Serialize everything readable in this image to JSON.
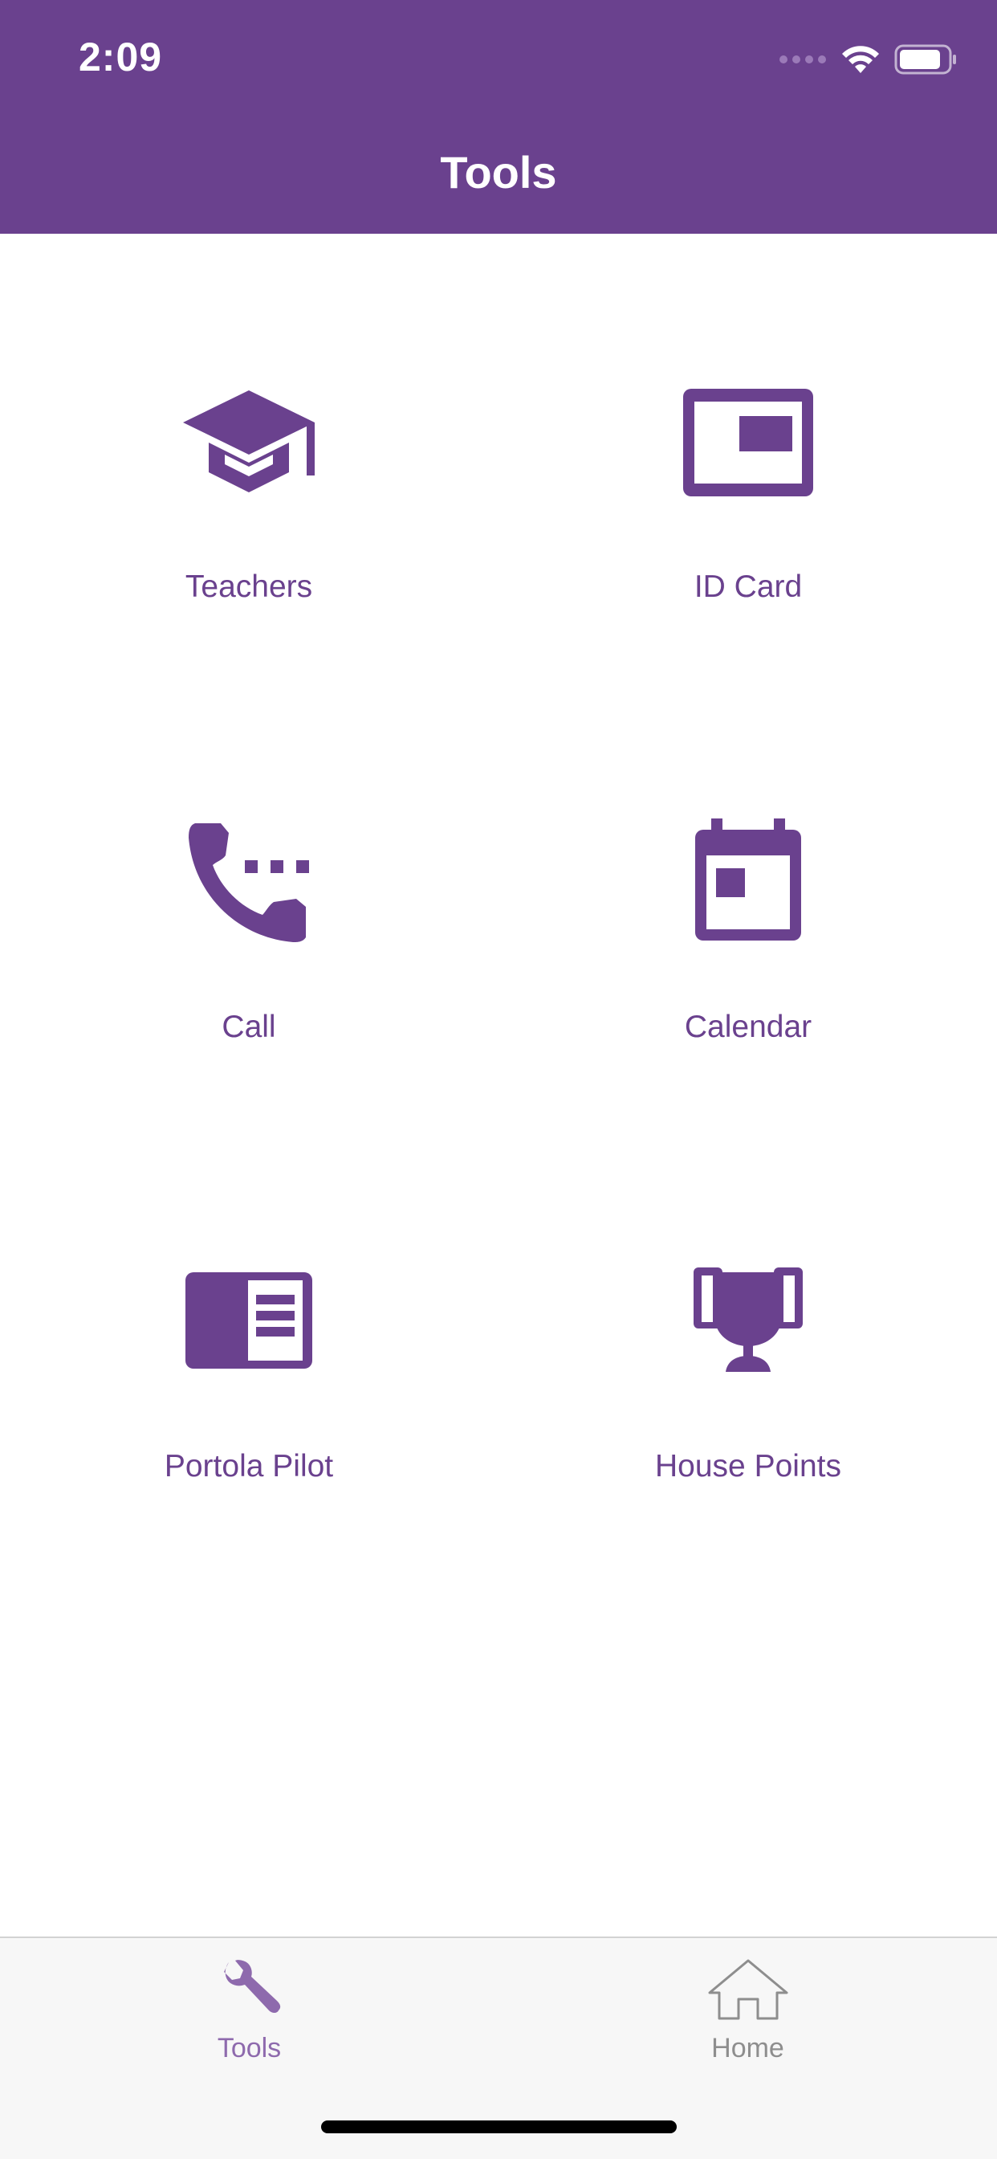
{
  "status_bar": {
    "time": "2:09"
  },
  "header": {
    "title": "Tools"
  },
  "colors": {
    "brand_purple": "#6a418e",
    "tab_active": "#8e6aad",
    "tab_inactive": "#8e8e8e",
    "background": "#ffffff",
    "tab_bar_bg": "#f7f7f7"
  },
  "tools": [
    {
      "label": "Teachers",
      "icon": "graduation-cap-icon"
    },
    {
      "label": "ID Card",
      "icon": "id-card-icon"
    },
    {
      "label": "Call",
      "icon": "phone-call-icon"
    },
    {
      "label": "Calendar",
      "icon": "calendar-icon"
    },
    {
      "label": "Portola Pilot",
      "icon": "newspaper-icon"
    },
    {
      "label": "House Points",
      "icon": "trophy-icon"
    }
  ],
  "tab_bar": {
    "tabs": [
      {
        "label": "Tools",
        "icon": "wrench-icon",
        "active": true
      },
      {
        "label": "Home",
        "icon": "home-icon",
        "active": false
      }
    ]
  }
}
